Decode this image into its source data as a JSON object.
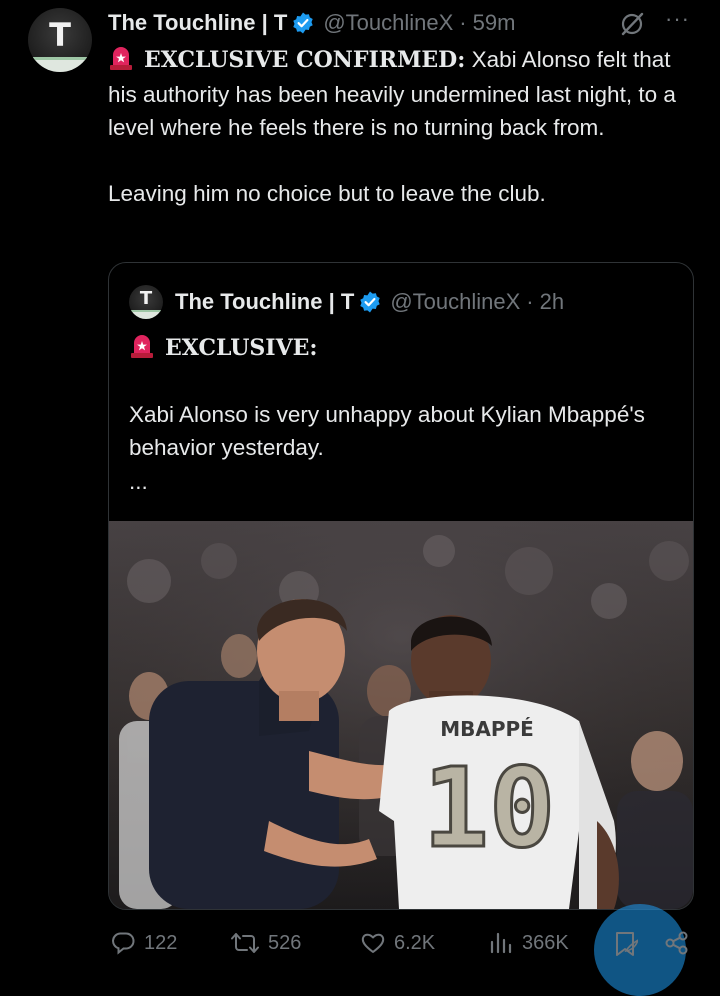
{
  "tweet": {
    "avatar_letter": "T",
    "display_name": "The Touchline | T",
    "handle": "@TouchlineX",
    "separator": "·",
    "time": "59m",
    "more_label": "···",
    "headline": "EXCLUSIVE CONFIRMED:",
    "text_line1_rest": " Xabi Alonso felt that his authority has been heavily undermined last night, to a level where he feels there is no turning back from.",
    "text_para2": "Leaving him no choice but to leave the club."
  },
  "quote": {
    "avatar_letter": "T",
    "display_name": "The Touchline | T",
    "handle": "@TouchlineX",
    "separator": "·",
    "time": "2h",
    "headline": "EXCLUSIVE:",
    "body": "Xabi Alonso is very unhappy about Kylian Mbappé's behavior yesterday.",
    "ellipsis": "...",
    "photo": {
      "jersey_name": "MBAPPÉ",
      "jersey_number": "10"
    }
  },
  "actions": {
    "replies": "122",
    "reposts": "526",
    "likes": "6.2K",
    "views": "366K"
  },
  "colors": {
    "background": "#000000",
    "text_primary": "#e7e9ea",
    "text_secondary": "#71767b",
    "verified_blue": "#1d9bf0",
    "siren_red": "#e0245e",
    "border": "#2f3336"
  },
  "icons": {
    "verified": "verified-badge-icon",
    "siren": "police-siren-icon",
    "grok": "grok-icon",
    "more": "more-icon",
    "reply": "reply-icon",
    "repost": "repost-icon",
    "like": "heart-icon",
    "views": "views-chart-icon",
    "bookmark": "bookmark-icon",
    "share": "share-icon"
  }
}
